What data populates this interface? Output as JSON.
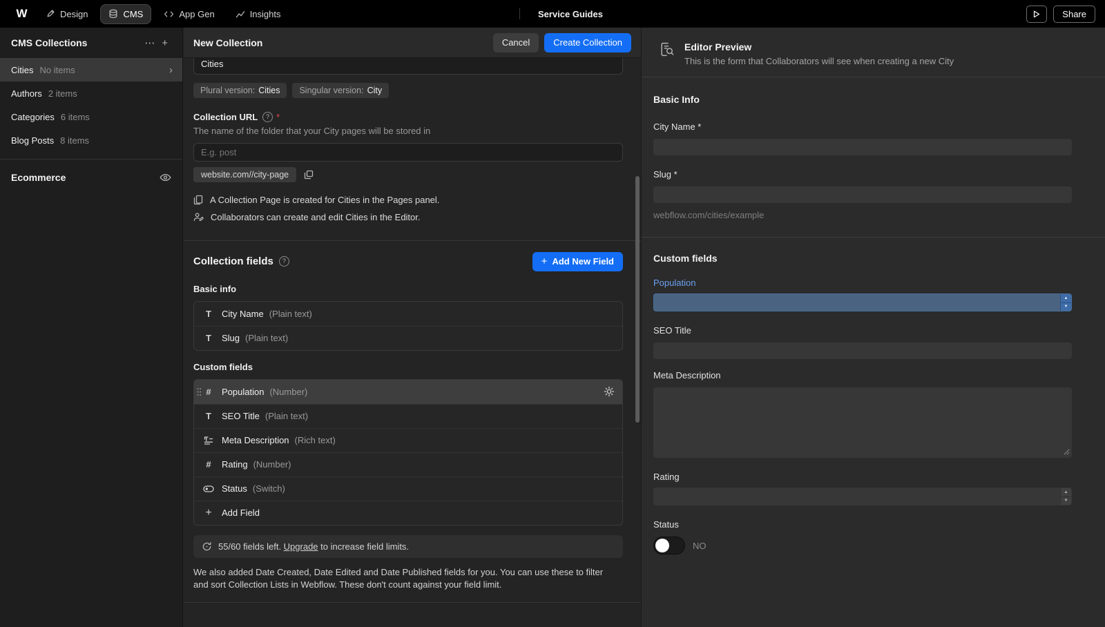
{
  "colors": {
    "accent": "#146ef5",
    "population_highlight": "#4a6380",
    "required": "#e5484d",
    "link_blue": "#6ba1f1"
  },
  "topbar": {
    "logo": "W",
    "nav": [
      {
        "label": "Design",
        "icon": "design-icon",
        "active": false
      },
      {
        "label": "CMS",
        "icon": "database-icon",
        "active": true
      },
      {
        "label": "App Gen",
        "icon": "code-icon",
        "active": false
      },
      {
        "label": "Insights",
        "icon": "chart-icon",
        "active": false
      }
    ],
    "site_name": "Service Guides",
    "play_label": "preview",
    "share_label": "Share"
  },
  "sidebar": {
    "title": "CMS Collections",
    "collections": [
      {
        "name": "Cities",
        "count": "No items",
        "selected": true
      },
      {
        "name": "Authors",
        "count": "2 items",
        "selected": false
      },
      {
        "name": "Categories",
        "count": "6 items",
        "selected": false
      },
      {
        "name": "Blog Posts",
        "count": "8 items",
        "selected": false
      }
    ],
    "ecommerce_label": "Ecommerce"
  },
  "main": {
    "title": "New Collection",
    "cancel_label": "Cancel",
    "create_label": "Create Collection",
    "name_value": "Cities",
    "plural_label": "Plural version:",
    "plural_value": "Cities",
    "singular_label": "Singular version:",
    "singular_value": "City",
    "url_label": "Collection URL",
    "required_mark": "*",
    "url_help": "The name of the folder that your City pages will be stored in",
    "url_placeholder": "E.g. post",
    "url_preview": "website.com//city-page",
    "info_page": "A Collection Page is created for Cities in the Pages panel.",
    "info_collab": "Collaborators can create and edit Cities in the Editor.",
    "fields_title": "Collection fields",
    "add_field_label": "Add New Field",
    "basic_group_label": "Basic info",
    "basic_fields": [
      {
        "icon": "plain-text-icon",
        "name": "City Name",
        "type": "(Plain text)"
      },
      {
        "icon": "plain-text-icon",
        "name": "Slug",
        "type": "(Plain text)"
      }
    ],
    "custom_group_label": "Custom fields",
    "custom_fields": [
      {
        "icon": "number-icon",
        "name": "Population",
        "type": "(Number)",
        "selected": true
      },
      {
        "icon": "plain-text-icon",
        "name": "SEO Title",
        "type": "(Plain text)"
      },
      {
        "icon": "rich-text-icon",
        "name": "Meta Description",
        "type": "(Rich text)"
      },
      {
        "icon": "number-icon",
        "name": "Rating",
        "type": "(Number)"
      },
      {
        "icon": "switch-icon",
        "name": "Status",
        "type": "(Switch)"
      },
      {
        "icon": "plus-icon",
        "name": "Add Field",
        "type": ""
      }
    ],
    "limit_text_pre": "55/60 fields left. ",
    "limit_link": "Upgrade",
    "limit_text_post": " to increase field limits.",
    "footer_note": "We also added Date Created, Date Edited and Date Published fields for you. You can use these to filter and sort Collection Lists in Webflow. These don't count against your field limit."
  },
  "preview": {
    "title": "Editor Preview",
    "subtitle": "This is the form that Collaborators will see when creating a new City",
    "basic_section_title": "Basic Info",
    "city_name_label": "City Name *",
    "slug_label": "Slug *",
    "slug_hint": "webflow.com/cities/example",
    "custom_section_title": "Custom fields",
    "population_label": "Population",
    "seo_title_label": "SEO Title",
    "meta_description_label": "Meta Description",
    "rating_label": "Rating",
    "status_label": "Status",
    "status_value": "NO"
  }
}
